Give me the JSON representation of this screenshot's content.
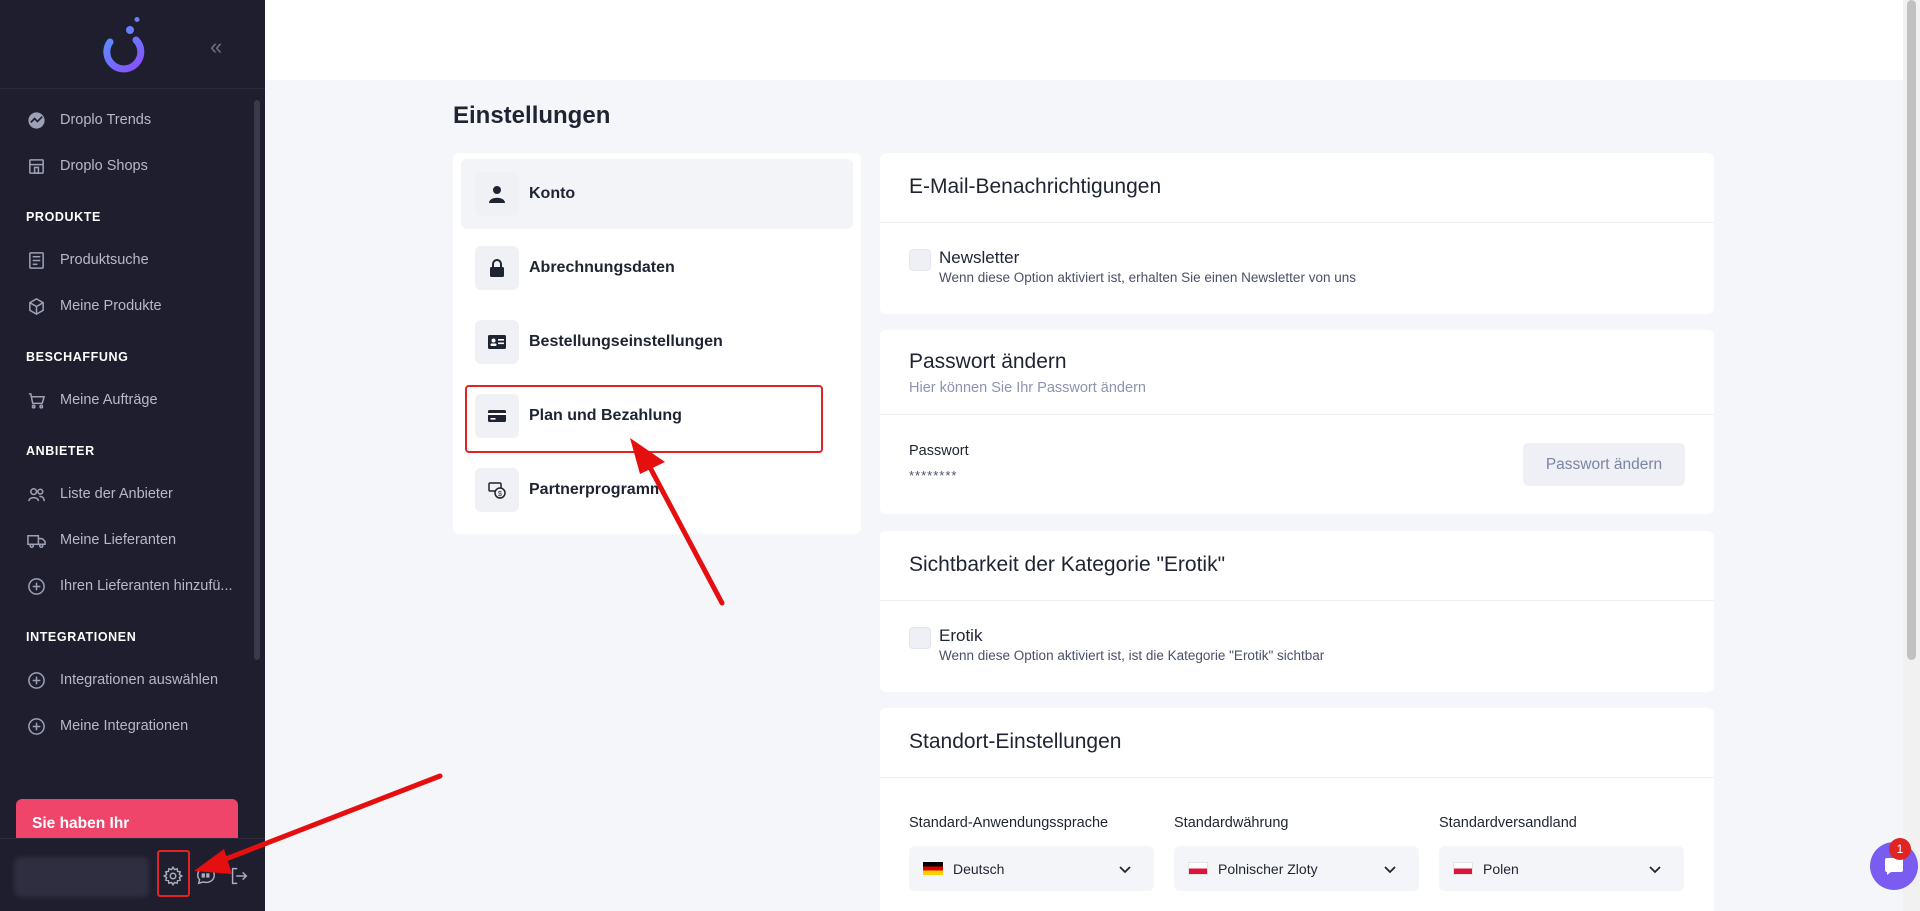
{
  "sidebar": {
    "top_items": [
      {
        "label": "Droplo Trends",
        "icon": "trend-icon"
      },
      {
        "label": "Droplo Shops",
        "icon": "shop-icon"
      }
    ],
    "sections": [
      {
        "title": "PRODUKTE",
        "items": [
          {
            "label": "Produktsuche",
            "icon": "search-list-icon"
          },
          {
            "label": "Meine Produkte",
            "icon": "box-icon"
          }
        ]
      },
      {
        "title": "BESCHAFFUNG",
        "items": [
          {
            "label": "Meine Aufträge",
            "icon": "cart-icon"
          }
        ]
      },
      {
        "title": "ANBIETER",
        "items": [
          {
            "label": "Liste der Anbieter",
            "icon": "users-icon"
          },
          {
            "label": "Meine Lieferanten",
            "icon": "truck-icon"
          },
          {
            "label": "Ihren Lieferanten hinzufü...",
            "icon": "plus-circle-icon"
          }
        ]
      },
      {
        "title": "INTEGRATIONEN",
        "items": [
          {
            "label": "Integrationen auswählen",
            "icon": "plus-circle-icon"
          },
          {
            "label": "Meine Integrationen",
            "icon": "plus-circle-icon"
          }
        ]
      }
    ],
    "promo_text": "Sie haben Ihr"
  },
  "page": {
    "title": "Einstellungen"
  },
  "settings_menu": [
    {
      "label": "Konto",
      "icon": "user-icon",
      "active": true
    },
    {
      "label": "Abrechnungsdaten",
      "icon": "lock-icon",
      "active": false
    },
    {
      "label": "Bestellungseinstellungen",
      "icon": "id-card-icon",
      "active": false
    },
    {
      "label": "Plan und Bezahlung",
      "icon": "credit-card-icon",
      "active": false
    },
    {
      "label": "Partnerprogramm",
      "icon": "money-transfer-icon",
      "active": false
    }
  ],
  "email_card": {
    "title": "E-Mail-Benachrichtigungen",
    "option_title": "Newsletter",
    "option_desc": "Wenn diese Option aktiviert ist, erhalten Sie einen Newsletter von uns"
  },
  "password_card": {
    "title": "Passwort ändern",
    "subtitle": "Hier können Sie Ihr Passwort ändern",
    "label": "Passwort",
    "value": "********",
    "button": "Passwort ändern"
  },
  "erotik_card": {
    "title": "Sichtbarkeit der Kategorie \"Erotik\"",
    "option_title": "Erotik",
    "option_desc": "Wenn diese Option aktiviert ist, ist die Kategorie \"Erotik\" sichtbar"
  },
  "location_card": {
    "title": "Standort-Einstellungen",
    "fields": [
      {
        "label": "Standard-Anwendungssprache",
        "value": "Deutsch",
        "flag": "de"
      },
      {
        "label": "Standardwährung",
        "value": "Polnischer Zloty",
        "flag": "pl"
      },
      {
        "label": "Standardversandland",
        "value": "Polen",
        "flag": "pl"
      }
    ]
  },
  "chat": {
    "badge": "1"
  },
  "colors": {
    "accent": "#7b5cf0",
    "promo": "#f0456b",
    "highlight": "#e02424",
    "sidebar_bg": "#1f1e2e"
  }
}
